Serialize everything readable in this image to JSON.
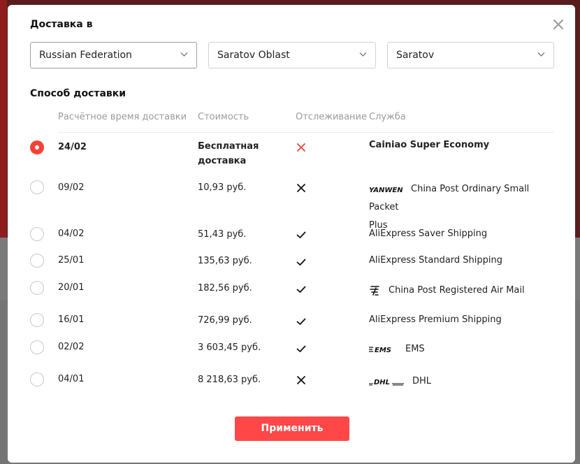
{
  "modal": {
    "delivery_to_title": "Доставка в",
    "country": "Russian Federation",
    "region": "Saratov Oblast",
    "city": "Saratov",
    "method_title": "Способ доставки"
  },
  "table": {
    "headers": {
      "time": "Расчётное время доставки",
      "cost": "Стоимость",
      "tracking": "Отслеживание",
      "service": "Служба"
    },
    "rows": [
      {
        "date": "24/02",
        "cost_line1": "Бесплатная",
        "cost_line2": "доставка",
        "tracking": "none-red",
        "service_logo": "",
        "service": "Cainiao Super Economy",
        "selected": true
      },
      {
        "date": "09/02",
        "cost": "10,93 руб.",
        "tracking": "none",
        "service_logo": "yanwen-logo",
        "service_line1": "China Post Ordinary Small Packet",
        "service_line2": "Plus",
        "selected": false
      },
      {
        "date": "04/02",
        "cost": "51,43 руб.",
        "tracking": "yes",
        "service_logo": "",
        "service": "AliExpress Saver Shipping",
        "selected": false
      },
      {
        "date": "25/01",
        "cost": "135,63 руб.",
        "tracking": "yes",
        "service_logo": "",
        "service": "AliExpress Standard Shipping",
        "selected": false
      },
      {
        "date": "20/01",
        "cost": "182,56 руб.",
        "tracking": "yes",
        "service_logo": "china-post-logo",
        "service": "China Post Registered Air Mail",
        "selected": false
      },
      {
        "date": "16/01",
        "cost": "726,99 руб.",
        "tracking": "yes",
        "service_logo": "",
        "service": "AliExpress Premium Shipping",
        "selected": false
      },
      {
        "date": "02/02",
        "cost": "3 603,45 руб.",
        "tracking": "yes",
        "service_logo": "ems-logo",
        "service": "EMS",
        "selected": false
      },
      {
        "date": "04/01",
        "cost": "8 218,63 руб.",
        "tracking": "none",
        "service_logo": "dhl-logo",
        "service": "DHL",
        "selected": false
      }
    ]
  },
  "apply_button": "Применить",
  "colors": {
    "accent": "#ff4747",
    "radio_checked": "#f44336",
    "muted_text": "#9b9b9b"
  }
}
